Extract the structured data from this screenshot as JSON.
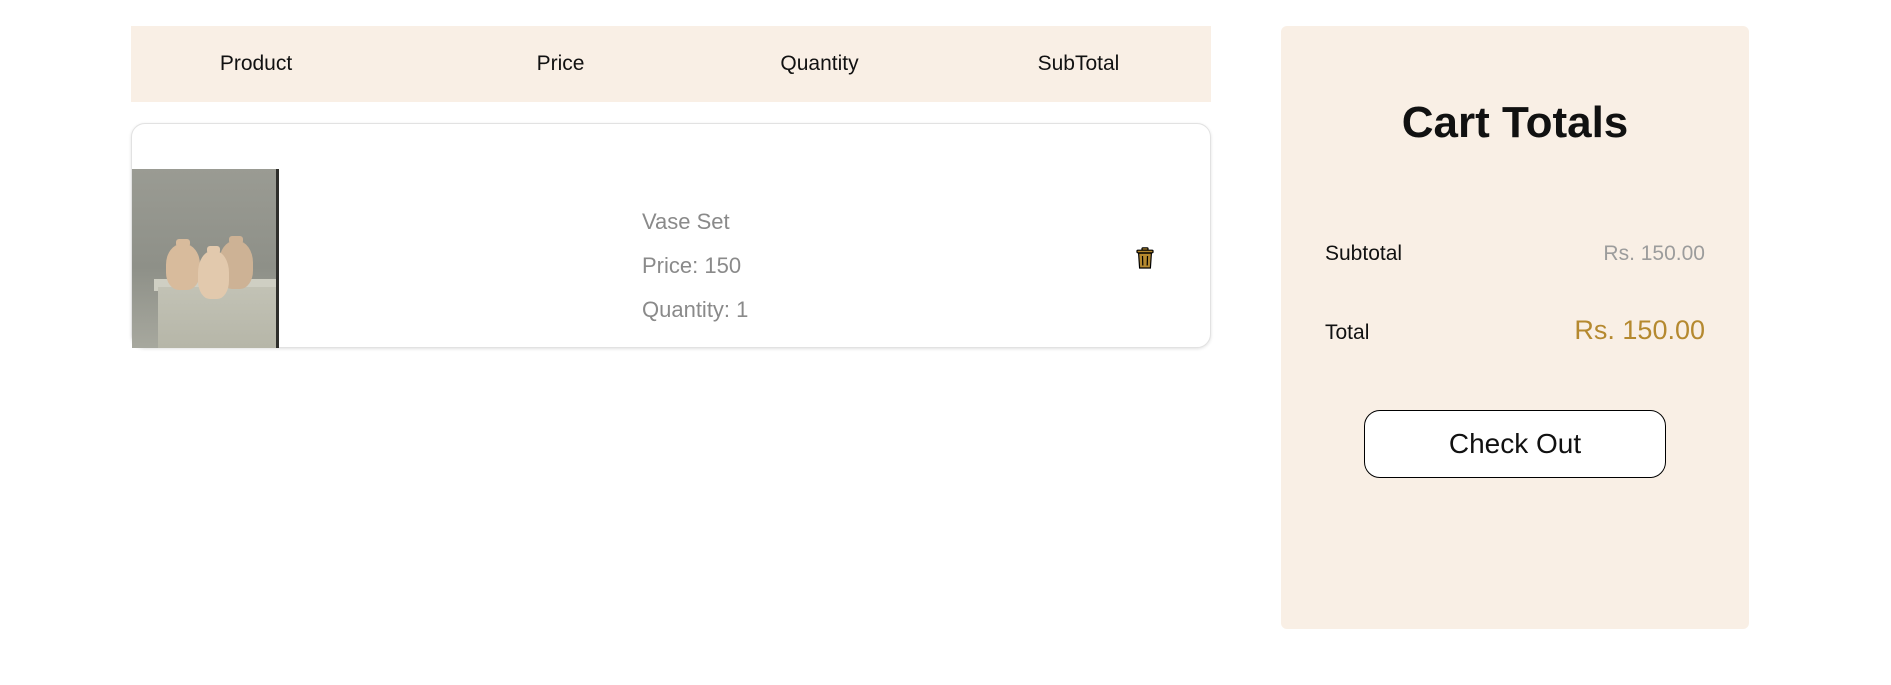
{
  "cart_table": {
    "headers": [
      "Product",
      "Price",
      "Quantity",
      "SubTotal"
    ]
  },
  "cart_items": [
    {
      "image_icon": "vase-set-photo",
      "name": "Vase Set",
      "price_text": "Price: 150",
      "quantity_text": "Quantity: 1",
      "delete_icon": "trash-icon"
    }
  ],
  "cart_totals": {
    "title": "Cart Totals",
    "subtotal_label": "Subtotal",
    "subtotal_value": "Rs. 150.00",
    "total_label": "Total",
    "total_value": "Rs. 150.00",
    "checkout_label": "Check Out"
  },
  "colors": {
    "panel_bg": "#f9efe5",
    "accent_gold": "#b5892f",
    "muted_text": "#8a8a8a"
  }
}
